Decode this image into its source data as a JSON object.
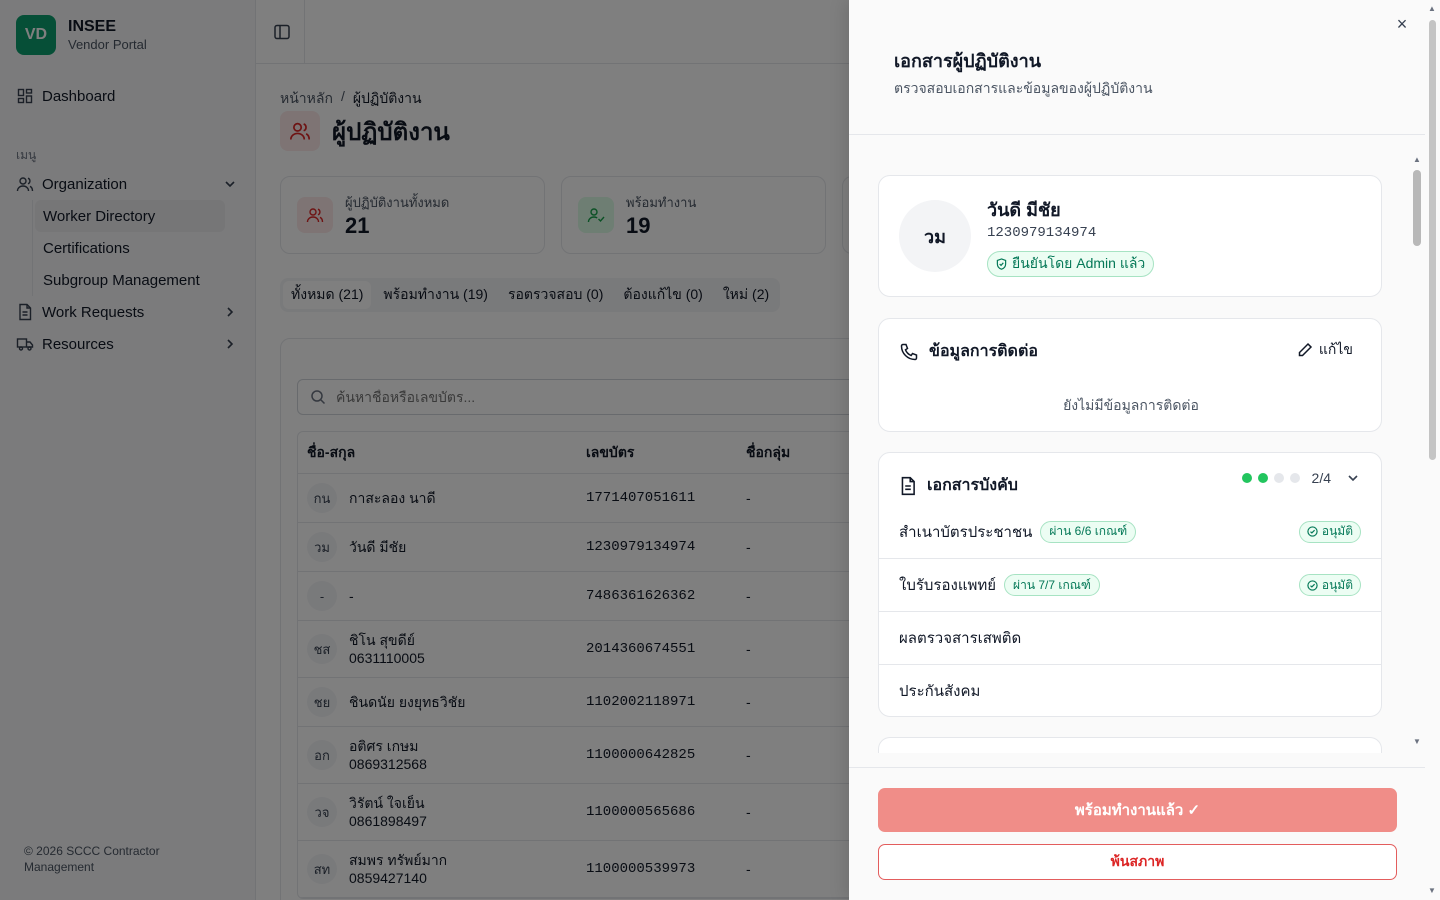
{
  "brand": {
    "logo": "VD",
    "name": "INSEE",
    "subtitle": "Vendor Portal"
  },
  "sidebar": {
    "dashboard": "Dashboard",
    "section_label": "เมนู",
    "organization": "Organization",
    "sub_items": [
      "Worker Directory",
      "Certifications",
      "Subgroup Management"
    ],
    "work_requests": "Work Requests",
    "resources": "Resources",
    "footer": "© 2026 SCCC Contractor Management"
  },
  "breadcrumb": {
    "home": "หน้าหลัก",
    "sep": "/",
    "current": "ผู้ปฏิบัติงาน"
  },
  "page_title": "ผู้ปฏิบัติงาน",
  "stats": [
    {
      "label": "ผู้ปฏิบัติงานทั้งหมด",
      "value": "21"
    },
    {
      "label": "พร้อมทำงาน",
      "value": "19"
    }
  ],
  "tabs": [
    "ทั้งหมด (21)",
    "พร้อมทำงาน (19)",
    "รอตรวจสอบ (0)",
    "ต้องแก้ไข (0)",
    "ใหม่ (2)"
  ],
  "search": {
    "placeholder": "ค้นหาชื่อหรือเลขบัตร..."
  },
  "table": {
    "headers": [
      "ชื่อ-สกุล",
      "เลขบัตร",
      "ชื่อกลุ่ม"
    ],
    "rows": [
      {
        "initials": "กน",
        "name": "กาสะลอง นาดี",
        "phone": "",
        "id": "1771407051611",
        "group": "-"
      },
      {
        "initials": "วม",
        "name": "วันดี มีชัย",
        "phone": "",
        "id": "1230979134974",
        "group": "-"
      },
      {
        "initials": "-",
        "name": "-",
        "phone": "",
        "id": "7486361626362",
        "group": "-"
      },
      {
        "initials": "ชส",
        "name": "ชิโน สุขดีย์",
        "phone": "0631110005",
        "id": "2014360674551",
        "group": "-"
      },
      {
        "initials": "ชย",
        "name": "ชินดนัย ยงยุทธวิชัย",
        "phone": "",
        "id": "1102002118971",
        "group": "-"
      },
      {
        "initials": "อก",
        "name": "อติศร เกษม",
        "phone": "0869312568",
        "id": "1100000642825",
        "group": "-"
      },
      {
        "initials": "วจ",
        "name": "วิรัตน์ ใจเย็น",
        "phone": "0861898497",
        "id": "1100000565686",
        "group": "-"
      },
      {
        "initials": "สท",
        "name": "สมพร ทรัพย์มาก",
        "phone": "0859427140",
        "id": "1100000539973",
        "group": "-"
      }
    ]
  },
  "drawer": {
    "title": "เอกสารผู้ปฏิบัติงาน",
    "description": "ตรวจสอบเอกสารและข้อมูลของผู้ปฏิบัติงาน",
    "close": "×",
    "profile": {
      "initials": "วม",
      "name": "วันดี มีชัย",
      "id": "1230979134974",
      "verified": "ยืนยันโดย Admin แล้ว"
    },
    "contact": {
      "title": "ข้อมูลการติดต่อ",
      "edit": "แก้ไข",
      "empty": "ยังไม่มีข้อมูลการติดต่อ"
    },
    "documents": {
      "title": "เอกสารบังคับ",
      "progress": "2/4",
      "completed": 2,
      "total": 4,
      "items": [
        {
          "name": "สำเนาบัตรประชาชน",
          "pass": "ผ่าน 6/6 เกณฑ์",
          "status": "อนุมัติ"
        },
        {
          "name": "ใบรับรองแพทย์",
          "pass": "ผ่าน 7/7 เกณฑ์",
          "status": "อนุมัติ"
        },
        {
          "name": "ผลตรวจสารเสพติด",
          "pass": "",
          "status": ""
        },
        {
          "name": "ประกันสังคม",
          "pass": "",
          "status": ""
        }
      ]
    },
    "ready_button": "พร้อมทำงานแล้ว ✓",
    "suspend_button": "พ้นสภาพ"
  },
  "colors": {
    "brand": "#0d9f6e",
    "danger": "#dc2626",
    "success": "#22c55e",
    "ready_button": "#f08d88"
  }
}
